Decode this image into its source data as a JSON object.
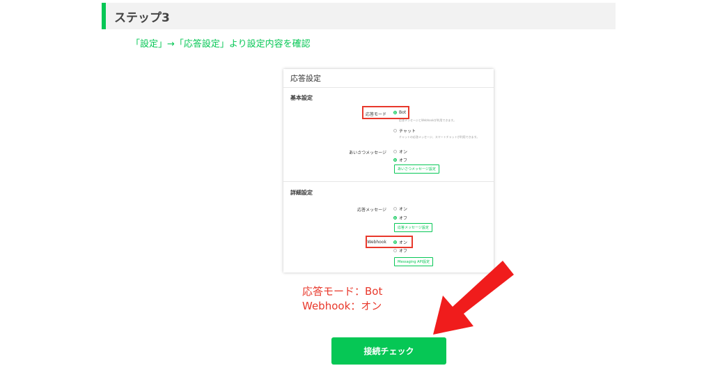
{
  "step": {
    "title": "ステップ3"
  },
  "instruction": "「設定」→「応答設定」より設定内容を確認",
  "panel": {
    "title": "応答設定",
    "basic": {
      "title": "基本設定",
      "response_mode": {
        "label": "応答モード",
        "options": [
          "Bot",
          "チャット"
        ],
        "selected": "Bot",
        "bot_helper": "応答メッセージとWebhookが利用できます。",
        "chat_helper": "チャットの応答メッセージ、スマートチャットが利用できます。"
      },
      "greeting": {
        "label": "あいさつメッセージ",
        "options": [
          "オン",
          "オフ"
        ],
        "selected": "オフ",
        "button": "あいさつメッセージ設定"
      }
    },
    "advanced": {
      "title": "詳細設定",
      "auto_reply": {
        "label": "応答メッセージ",
        "options": [
          "オン",
          "オフ"
        ],
        "selected": "オフ",
        "button": "応答メッセージ設定"
      },
      "webhook": {
        "label": "Webhook",
        "options": [
          "オン",
          "オフ"
        ],
        "selected": "オン",
        "button": "Messaging API設定"
      }
    }
  },
  "summary": {
    "line1": "応答モード：Bot",
    "line2": "Webhook：オン"
  },
  "connect_button": "接続チェック",
  "colors": {
    "accent": "#06c755",
    "highlight": "#e8382b",
    "arrow": "#f01c1c"
  },
  "icons": {
    "pointer": "arrow-icon"
  }
}
